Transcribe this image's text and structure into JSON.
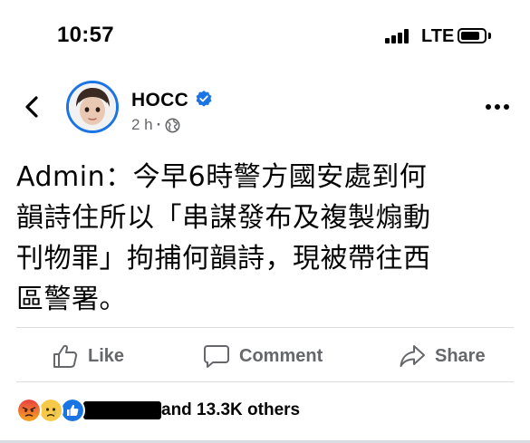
{
  "status_bar": {
    "time": "10:57",
    "network": "LTE",
    "signal_bars": 4,
    "battery_level": 0.85
  },
  "header": {
    "back_icon": "chevron-left-icon",
    "page_name": "HOCC",
    "verified_icon": "verified-badge-icon",
    "timestamp": "2 h",
    "separator": "·",
    "audience_icon": "globe-icon",
    "more_icon": "more-horizontal-icon"
  },
  "post": {
    "line1": "Admin：今早6時警方國安處到何",
    "line2": "韻詩住所以「串謀發布及複製煽動",
    "line3": "刊物罪」拘捕何韻詩，現被帶往西",
    "line4": "區警署。"
  },
  "actions": {
    "like_label": "Like",
    "comment_label": "Comment",
    "share_label": "Share"
  },
  "reactions": {
    "icons": [
      "angry-reaction-icon",
      "sad-reaction-icon",
      "like-reaction-icon"
    ],
    "others_text": "and 13.3K others"
  },
  "colors": {
    "accent": "#1b74e4",
    "secondary_text": "#65676b",
    "divider": "#dadde1"
  }
}
